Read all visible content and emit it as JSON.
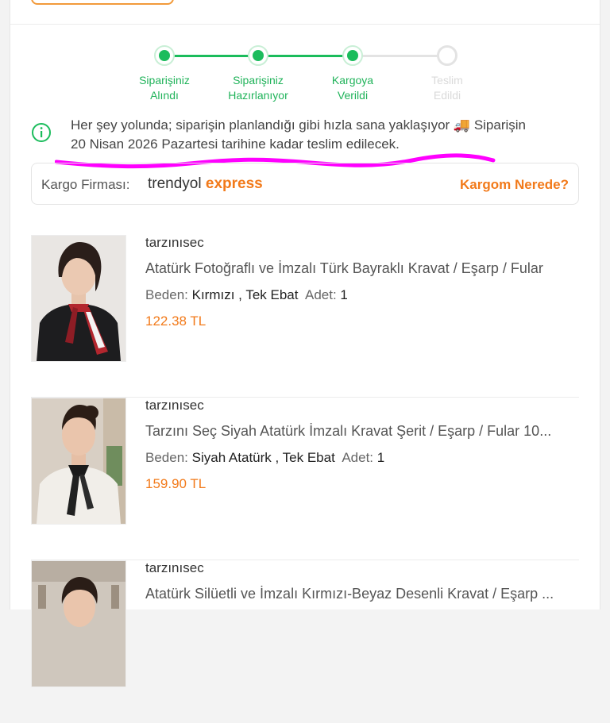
{
  "tracker": {
    "steps": [
      {
        "line1": "Siparişiniz",
        "line2": "Alındı",
        "status": "done"
      },
      {
        "line1": "Siparişiniz",
        "line2": "Hazırlanıyor",
        "status": "done"
      },
      {
        "line1": "Kargoya",
        "line2": "Verildi",
        "status": "done"
      },
      {
        "line1": "Teslim",
        "line2": "Edildi",
        "status": "pending"
      }
    ]
  },
  "info": {
    "line1": "Her şey yolunda; siparişin planlandığı gibi hızla sana yaklaşıyor 🚚 Siparişin",
    "line2": "20 Nisan 2026 Pazartesi tarihine kadar teslim edilecek."
  },
  "cargo": {
    "label": "Kargo Firması:",
    "brand_part1": "trendyol",
    "brand_part2": "express",
    "track_link": "Kargom Nerede?"
  },
  "products": [
    {
      "seller": "tarzınısec",
      "name": "Atatürk Fotoğraflı ve İmzalı Türk Bayraklı Kravat / Eşarp / Fular",
      "size_label": "Beden:",
      "size_value": "Kırmızı , Tek Ebat",
      "qty_label": "Adet:",
      "qty_value": "1",
      "price": "122.38 TL"
    },
    {
      "seller": "tarzınısec",
      "name": "Tarzını Seç Siyah Atatürk İmzalı Kravat Şerit / Eşarp / Fular 10...",
      "size_label": "Beden:",
      "size_value": "Siyah Atatürk , Tek Ebat",
      "qty_label": "Adet:",
      "qty_value": "1",
      "price": "159.90 TL"
    },
    {
      "seller": "tarzınısec",
      "name": "Atatürk Silüetli ve İmzalı Kırmızı-Beyaz Desenli Kravat / Eşarp ...",
      "size_label": "",
      "size_value": "",
      "qty_label": "",
      "qty_value": "",
      "price": ""
    }
  ],
  "colors": {
    "accent_orange": "#f27a1a",
    "progress_green": "#1bbc5c",
    "annotation_magenta": "#ff00ff"
  }
}
